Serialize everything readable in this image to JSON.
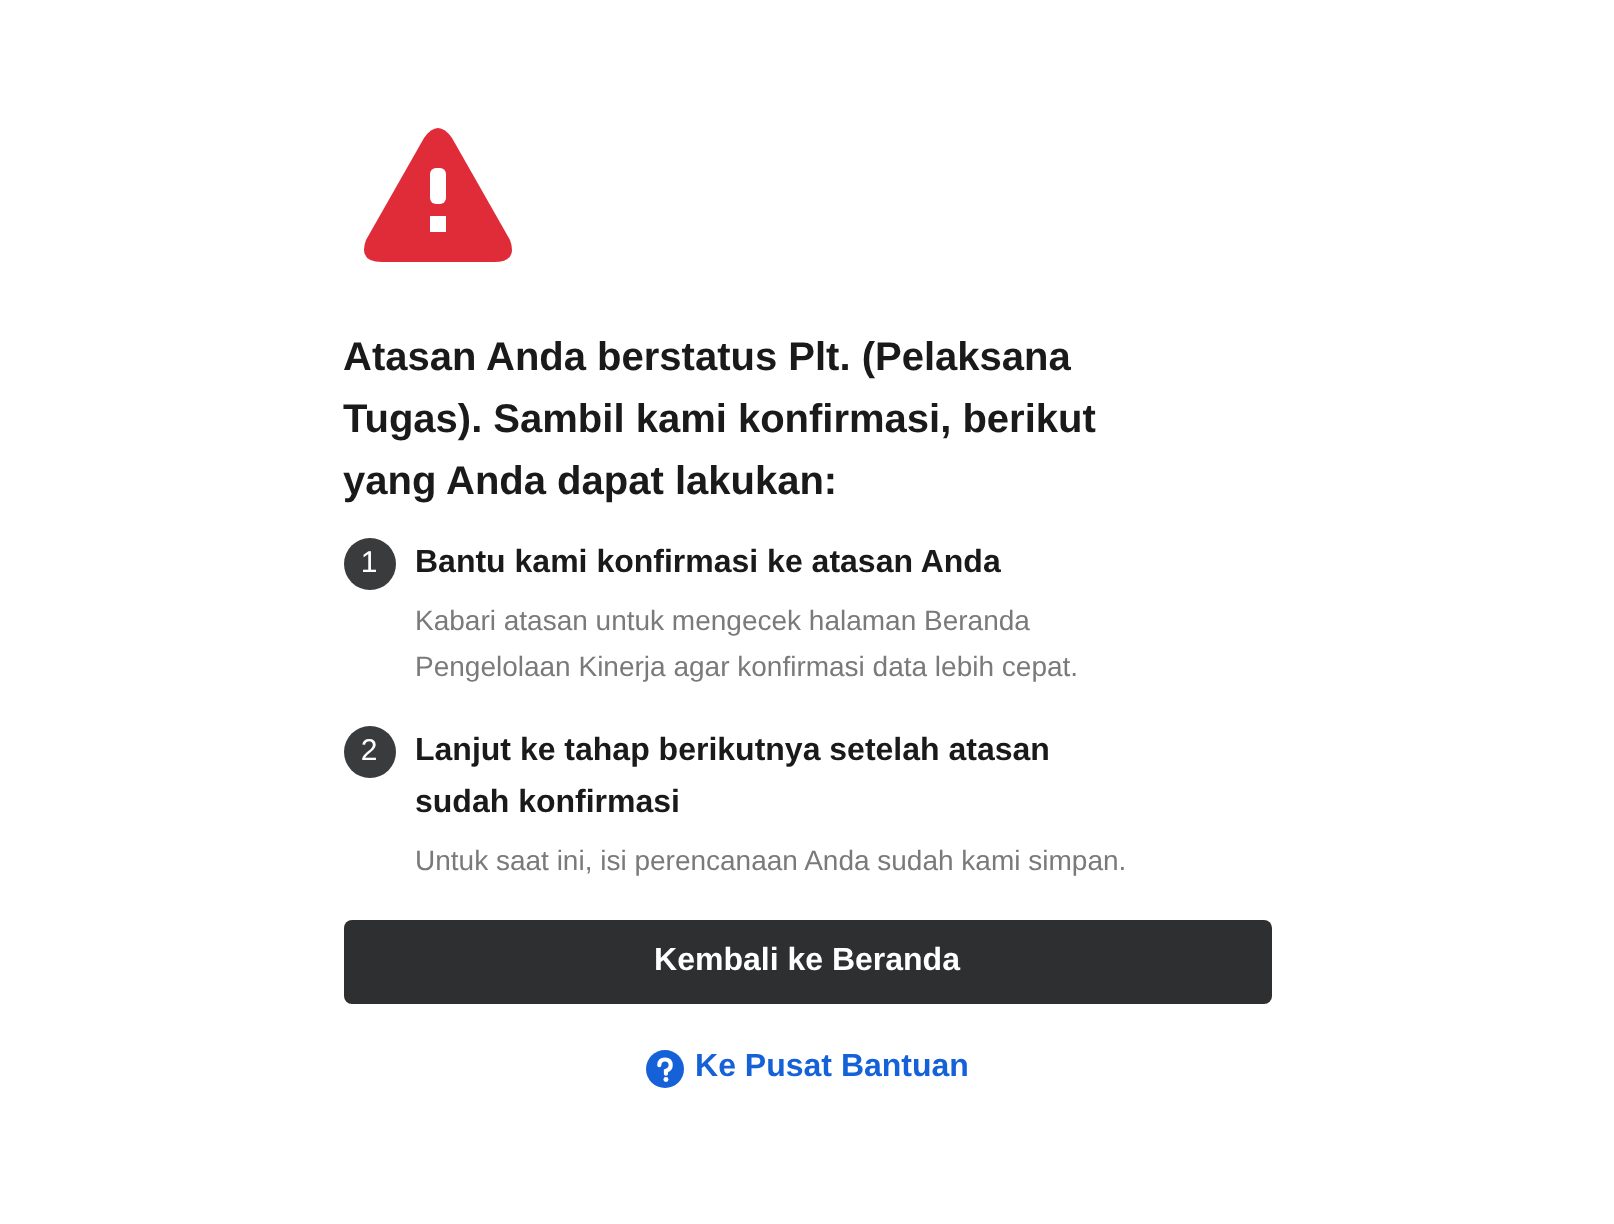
{
  "heading": "Atasan Anda berstatus Plt. (Pelaksana Tugas). Sambil kami konfirmasi, berikut yang Anda dapat lakukan:",
  "steps": [
    {
      "number": "1",
      "title": "Bantu kami konfirmasi ke atasan Anda",
      "description": "Kabari atasan untuk mengecek halaman Beranda Pengelolaan Kinerja agar konfirmasi data lebih cepat."
    },
    {
      "number": "2",
      "title": "Lanjut ke tahap berikutnya setelah atasan sudah konfirmasi",
      "description": "Untuk saat ini, isi perencanaan Anda sudah kami simpan."
    }
  ],
  "primary_button": "Kembali ke Beranda",
  "help_link": "Ke Pusat Bantuan"
}
